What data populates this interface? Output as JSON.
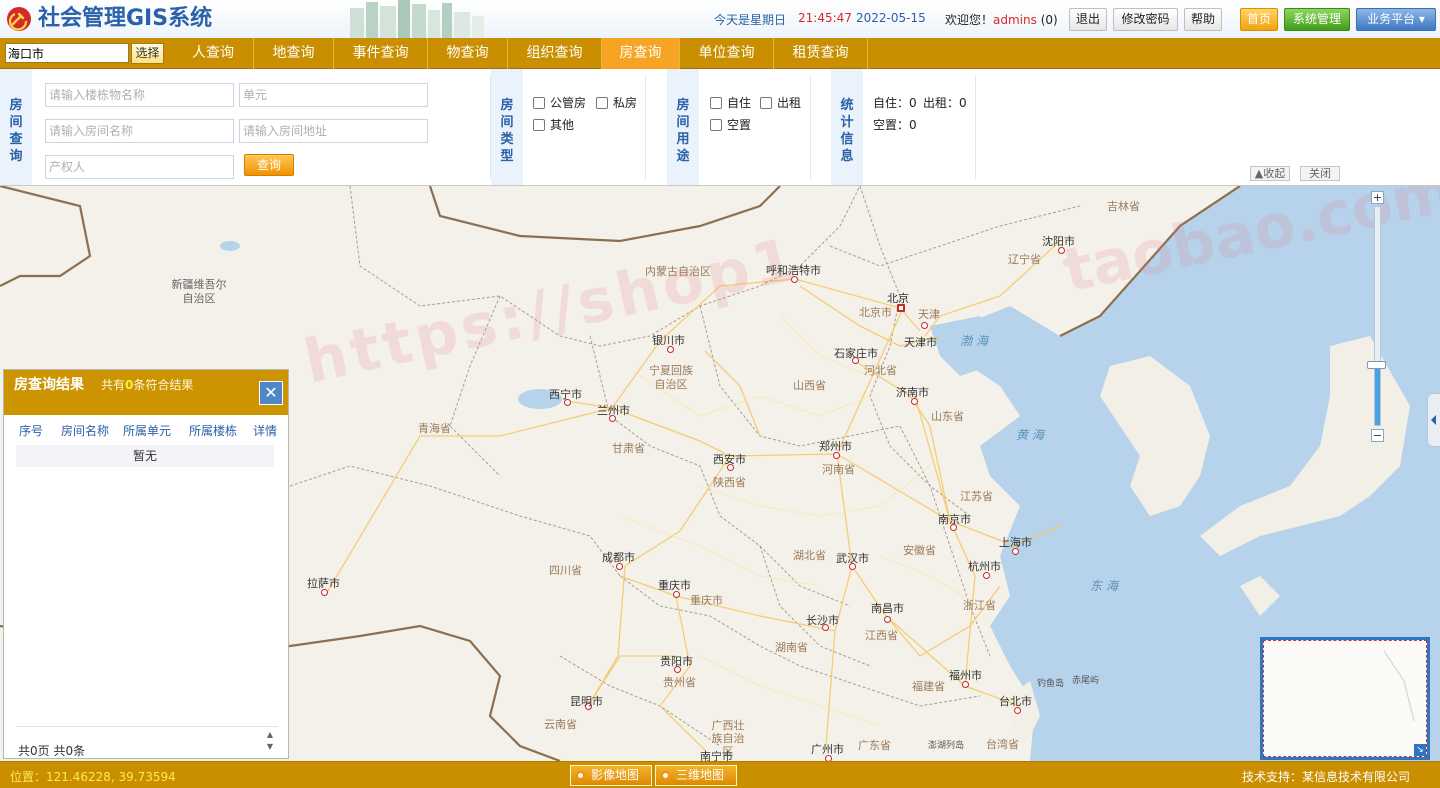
{
  "header": {
    "title": "社会管理GIS系统",
    "weekday": "今天是星期日",
    "time": "21:45:47",
    "date": "2022-05-15",
    "welcome": "欢迎您！",
    "username": "admins",
    "msg_count": "(0)",
    "buttons": {
      "logout": "退出",
      "change_password": "修改密码",
      "help": "帮助",
      "home": "首页",
      "system": "系统管理",
      "platform": "业务平台 ▾"
    }
  },
  "nav": {
    "city_value": "海口市",
    "select_label": "选择",
    "tabs": [
      {
        "label": "人查询"
      },
      {
        "label": "地查询"
      },
      {
        "label": "事件查询"
      },
      {
        "label": "物查询"
      },
      {
        "label": "组织查询"
      },
      {
        "label": "房查询"
      },
      {
        "label": "单位查询"
      },
      {
        "label": "租赁查询"
      }
    ],
    "active_tab": "房查询"
  },
  "query": {
    "section_label": "房间查询",
    "placeholders": {
      "building_name": "请输入楼栋物名称",
      "unit": "单元",
      "room_name": "请输入房间名称",
      "room_address": "请输入房间地址",
      "owner": "产权人"
    },
    "search_label": "查询",
    "type_label": "房间类型",
    "types": [
      "公管房",
      "私房",
      "其他"
    ],
    "usage_label": "房间用途",
    "usages": [
      "自住",
      "出租",
      "空置"
    ],
    "stats_label": "统计信息",
    "stats": {
      "self_live": "自住：0",
      "rent": "出租：0",
      "vacant": "空置：0"
    },
    "collapse_label": "▲收起",
    "close_label": "关闭"
  },
  "map": {
    "cities": [
      "北京",
      "天津市",
      "石家庄市",
      "济南市",
      "郑州市",
      "西安市",
      "兰州市",
      "西宁市",
      "银川市",
      "呼和浩特市",
      "沈阳市",
      "上海市",
      "南京市",
      "杭州市",
      "武汉市",
      "长沙市",
      "南昌市",
      "福州市",
      "台北市",
      "广州市",
      "南宁市",
      "贵阳市",
      "昆明市",
      "成都市",
      "重庆市",
      "拉萨市"
    ],
    "provinces": [
      "内蒙古自治区",
      "新疆维吾尔自治区",
      "青海省",
      "甘肃省",
      "宁夏回族自治区",
      "陕西省",
      "山西省",
      "河北省",
      "山东省",
      "河南省",
      "北京市",
      "天津",
      "辽宁省",
      "吉林省",
      "江苏省",
      "安徽省",
      "湖北省",
      "浙江省",
      "湖南省",
      "江西省",
      "福建省",
      "四川省",
      "重庆市",
      "贵州省",
      "云南省",
      "广西壮族自治区",
      "广东省",
      "台湾省"
    ],
    "seas": [
      "渤海",
      "黄海",
      "东海"
    ],
    "islands": [
      "钓鱼岛",
      "赤尾屿",
      "澎湖列岛"
    ],
    "zoom_plus": "+",
    "zoom_minus": "−",
    "zoom_level_fraction": 0.27
  },
  "results": {
    "title": "房查询结果",
    "subtitle_prefix": "共有",
    "count": "0",
    "subtitle_suffix": "条符合结果",
    "close": "✕",
    "columns": [
      "序号",
      "房间名称",
      "所属单元",
      "所属楼栋",
      "详情"
    ],
    "empty_text": "暂无",
    "footer": "共0页  共0条"
  },
  "statusbar": {
    "position_text": "位置：121.46228, 39.73594",
    "imagery_map": "影像地图",
    "three_d_map": "三维地图",
    "credit": "技术支持：某信息技术有限公司"
  }
}
